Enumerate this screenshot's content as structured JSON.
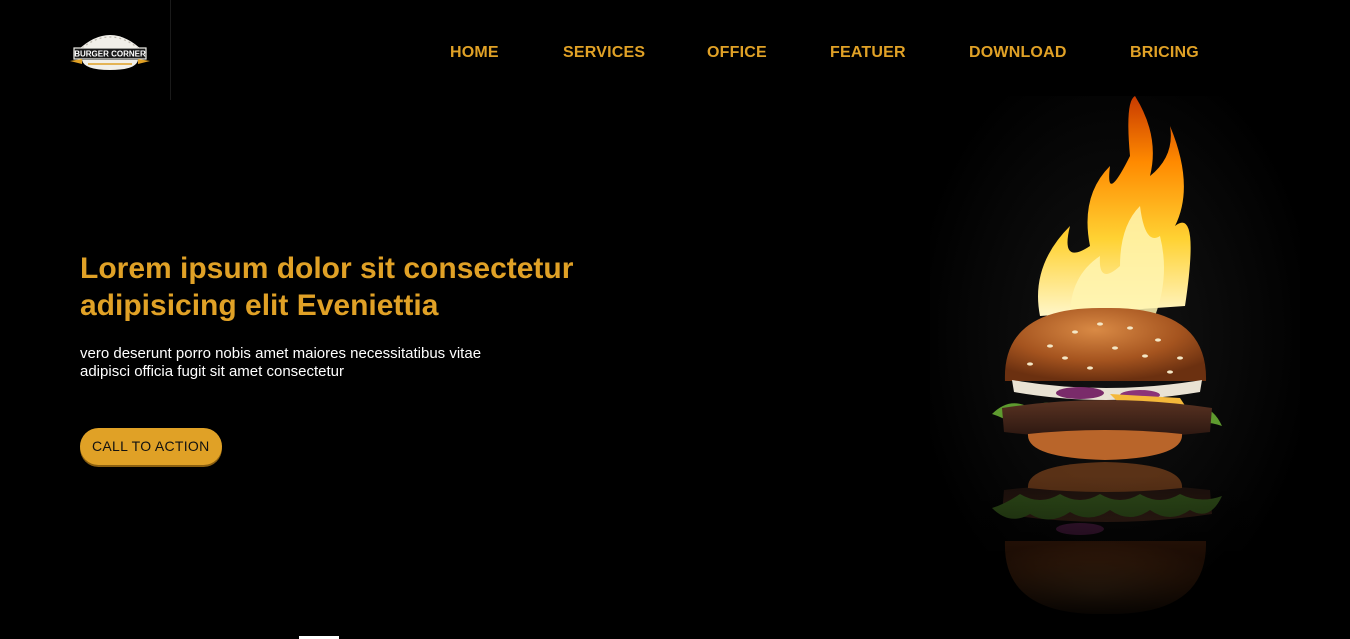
{
  "logo": {
    "text": "BURGER CORNER",
    "icon": "burger-corner-logo"
  },
  "nav": {
    "items": [
      {
        "label": "HOME"
      },
      {
        "label": "SERVICES"
      },
      {
        "label": "OFFICE"
      },
      {
        "label": "FEATUER"
      },
      {
        "label": "DOWNLOAD"
      },
      {
        "label": "BRICING"
      }
    ]
  },
  "hero": {
    "title_line1": "Lorem ipsum dolor sit consectetur",
    "title_line2": "adipisicing elit Eveniettia",
    "text_line1": "vero deserunt porro nobis amet maiores necessitatibus vitae",
    "text_line2": "adipisci officia fugit sit amet consectetur",
    "cta_label": "CALL TO ACTION",
    "image": "flaming-burger-image"
  },
  "colors": {
    "accent": "#e0a126",
    "background": "#000000",
    "text": "#ffffff"
  }
}
